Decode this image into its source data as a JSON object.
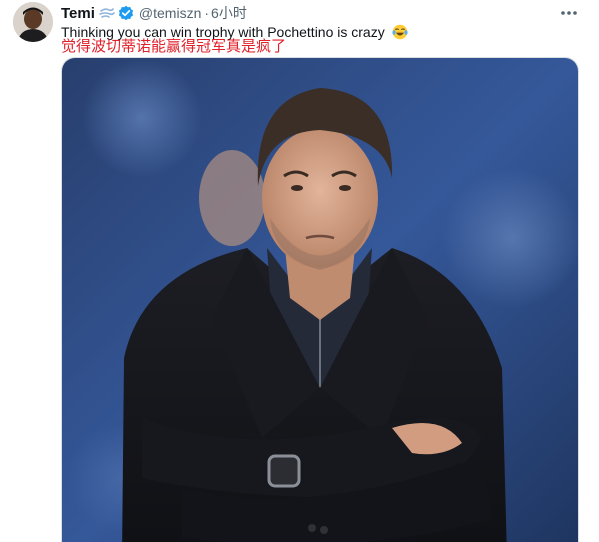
{
  "tweet": {
    "display_name": "Temi",
    "name_emoji": "dash-emoji",
    "verified_icon": "verified-badge-icon",
    "handle": "@temiszn",
    "separator": "·",
    "time": "6小时",
    "text": "Thinking you can win trophy with Pochettino is crazy",
    "text_emoji": "face-with-tears-of-joy-emoji",
    "translation": "觉得波切蒂诺能赢得冠军真是疯了",
    "more_icon": "more-dots-icon"
  },
  "colors": {
    "name": "#0f1419",
    "handle": "#536471",
    "verified": "#1d9bf0",
    "translation": "#e0202a",
    "coat": "#15161b",
    "photo_bg": "#2f4f88"
  }
}
